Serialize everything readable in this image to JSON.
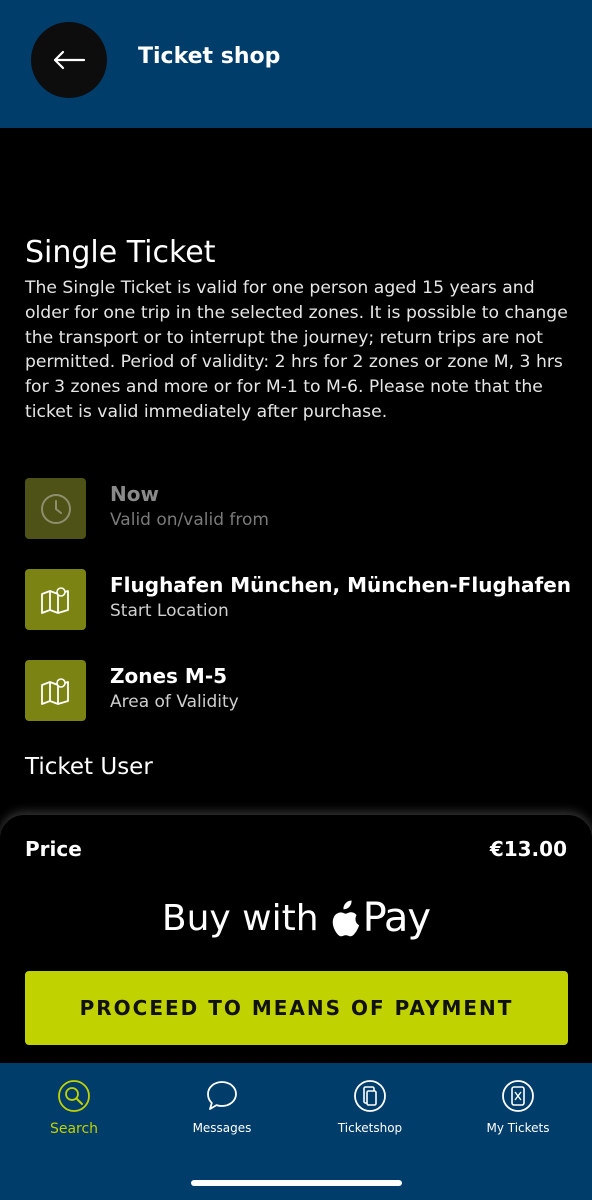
{
  "header": {
    "title": "Ticket shop",
    "back_icon": "arrow-left-icon"
  },
  "ticket": {
    "title": "Single Ticket",
    "description": "The Single Ticket is valid for one person aged 15 years and older for one trip in the selected zones. It is possible to change the transport or to interrupt the journey; return trips are not permitted. Period of validity: 2 hrs for 2 zones or zone M, 3 hrs for 3 zones and more or for M-1 to M-6. Please note that the ticket is valid immediately after purchase."
  },
  "options": [
    {
      "main": "Now",
      "sub": "Valid on/valid from",
      "icon": "clock-icon",
      "enabled": false
    },
    {
      "main": "Flughafen München, München-Flughafen",
      "sub": "Start Location",
      "icon": "map-icon",
      "enabled": true
    },
    {
      "main": "Zones M-5",
      "sub": "Area of Validity",
      "icon": "map-icon",
      "enabled": true
    }
  ],
  "ticket_user": {
    "title": "Ticket User"
  },
  "checkout": {
    "price_label": "Price",
    "price_value": "€13.00",
    "apple_pay_prefix": "Buy with",
    "apple_pay_word": "Pay",
    "proceed_label": "PROCEED TO MEANS OF PAYMENT"
  },
  "tabs": [
    {
      "label": "Search",
      "icon": "search-icon",
      "active": true
    },
    {
      "label": "Messages",
      "icon": "chat-bubble-icon",
      "active": false
    },
    {
      "label": "Ticketshop",
      "icon": "ticketshop-icon",
      "active": false
    },
    {
      "label": "My Tickets",
      "icon": "my-tickets-icon",
      "active": false
    }
  ],
  "colors": {
    "header_bg": "#003d6b",
    "accent": "#c0d200",
    "icon_tile": "#7b8412",
    "icon_tile_disabled": "#4e5216"
  }
}
